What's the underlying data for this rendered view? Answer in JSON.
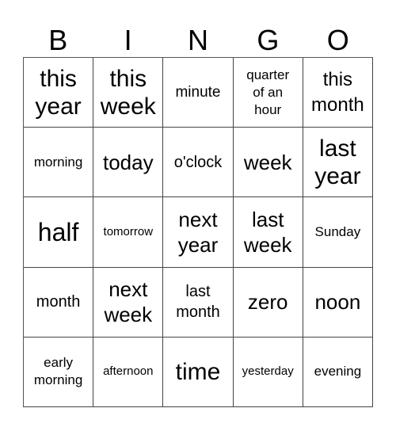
{
  "header": {
    "letters": [
      "B",
      "I",
      "N",
      "G",
      "O"
    ]
  },
  "board": {
    "rows": [
      [
        "this\nyear",
        "this\nweek",
        "minute",
        "quarter\nof an\nhour",
        "this\nmonth"
      ],
      [
        "morning",
        "today",
        "o'clock",
        "week",
        "last\nyear"
      ],
      [
        "half",
        "tomorrow",
        "next\nyear",
        "last\nweek",
        "Sunday"
      ],
      [
        "month",
        "next\nweek",
        "last\nmonth",
        "zero",
        "noon"
      ],
      [
        "early\nmorning",
        "afternoon",
        "time",
        "yesterday",
        "evening"
      ]
    ]
  },
  "colors": {
    "background": "#ffffff",
    "text": "#000000",
    "grid_lines": "#444444"
  }
}
